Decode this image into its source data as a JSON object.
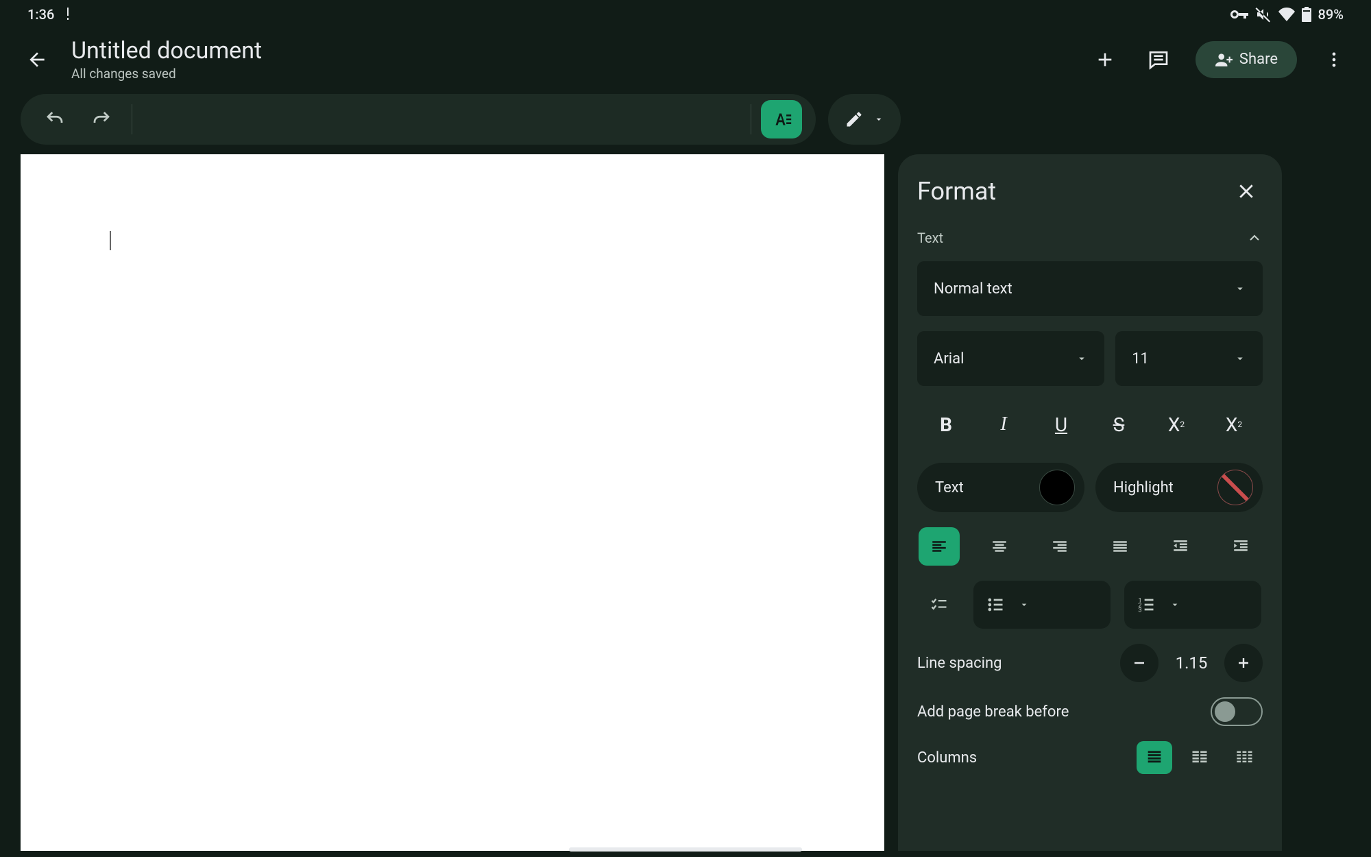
{
  "status": {
    "time": "1:36",
    "battery_pct": "89%"
  },
  "header": {
    "title": "Untitled document",
    "save_status": "All changes saved",
    "share_label": "Share"
  },
  "format_panel": {
    "title": "Format",
    "section_text": "Text",
    "style_select": "Normal text",
    "font_select": "Arial",
    "size_select": "11",
    "text_color_label": "Text",
    "highlight_label": "Highlight",
    "line_spacing_label": "Line spacing",
    "line_spacing_value": "1.15",
    "page_break_label": "Add page break before",
    "columns_label": "Columns"
  }
}
